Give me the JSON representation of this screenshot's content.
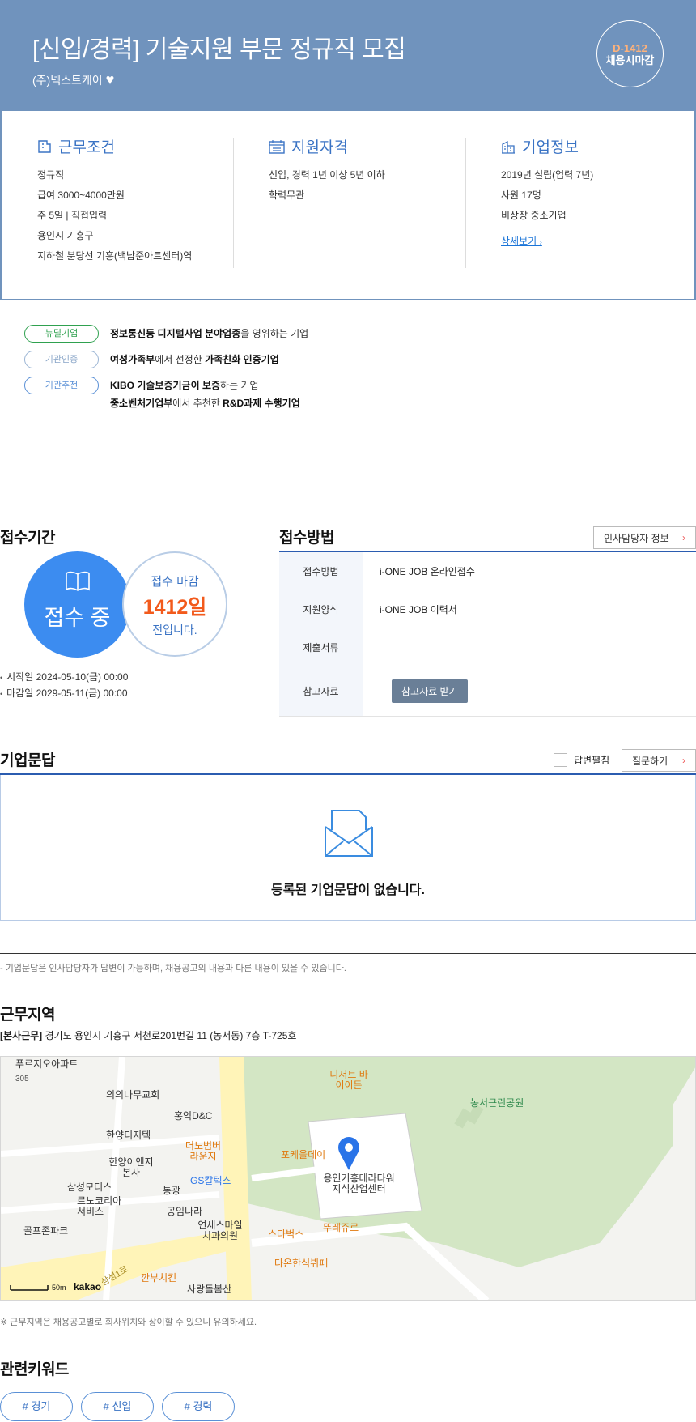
{
  "header": {
    "title": "[신입/경력] 기술지원 부문 정규직 모집",
    "company": "(주)넥스트케이",
    "dday": "D-1412",
    "deadline_type": "채용시마감",
    "bg_color": "#7093bd"
  },
  "conditions": {
    "title": "근무조건",
    "items": [
      "정규직",
      "급여 3000~4000만원",
      "주 5일 | 직접입력",
      "용인시 기흥구",
      "지하철 분당선 기흥(백남준아트센터)역"
    ]
  },
  "qualification": {
    "title": "지원자격",
    "items": [
      "신입, 경력 1년 이상 5년 이하",
      "학력무관"
    ]
  },
  "company_info": {
    "title": "기업정보",
    "items": [
      "2019년 설립(업력 7년)",
      "사원 17명",
      "비상장 중소기업"
    ],
    "more_label": "상세보기"
  },
  "badges": [
    {
      "label": "뉴딜기업",
      "lines": [
        [
          {
            "b": "정보통신등 디지털사업 분야업종"
          },
          {
            "t": "을 영위하는 기업"
          }
        ]
      ]
    },
    {
      "label": "기관인증",
      "lines": [
        [
          {
            "b": "여성가족부"
          },
          {
            "t": "에서 선정한 "
          },
          {
            "b": "가족친화 인증기업"
          }
        ]
      ]
    },
    {
      "label": "기관추천",
      "lines": [
        [
          {
            "b": "KIBO 기술보증기금이 보증"
          },
          {
            "t": "하는 기업"
          }
        ],
        [
          {
            "b": "중소벤처기업부"
          },
          {
            "t": "에서 추천한 "
          },
          {
            "b": "R&D과제 수행기업"
          }
        ]
      ]
    }
  ],
  "period": {
    "title": "접수기간",
    "status": "접수 중",
    "remain_top": "접수 마감",
    "remain_days": "1412일",
    "remain_bottom": "전입니다.",
    "start": "시작일 2024-05-10(금) 00:00",
    "end": "마감일 2029-05-11(금) 00:00"
  },
  "method": {
    "title": "접수방법",
    "hr_button": "인사담당자 정보",
    "rows": [
      {
        "key": "접수방법",
        "value": "i-ONE JOB 온라인접수"
      },
      {
        "key": "지원양식",
        "value": "i-ONE JOB 이력서"
      },
      {
        "key": "제출서류",
        "value": ""
      },
      {
        "key": "참고자료",
        "value": ""
      }
    ],
    "download_button": "참고자료 받기"
  },
  "qa": {
    "title": "기업문답",
    "expand_label": "답변펼침",
    "ask_button": "질문하기",
    "empty_message": "등록된 기업문답이 없습니다.",
    "note": "- 기업문답은 인사담당자가 답변이 가능하며, 채용공고의 내용과 다른 내용이 있을 수 있습니다."
  },
  "location": {
    "title": "근무지역",
    "tag": "[본사근무]",
    "address": "경기도 용인시 기흥구 서천로201번길 11 (농서동) 7층 T-725호",
    "note": "※ 근무지역은 채용공고별로 회사위치와 상이할 수 있으니 유의하세요.",
    "map_labels": [
      "푸르지오아파트",
      "305",
      "의의나무교회",
      "홍익D&C",
      "한양디지텍",
      "더노범버 라운지",
      "한양이엔지 본사",
      "삼성모터스",
      "통광",
      "GS칼텍스",
      "르노코리아 서비스",
      "공임나라",
      "연세스마일 치과의원",
      "골프존파크",
      "깐부치킨",
      "사랑돌봄산",
      "삼성1로",
      "디저트 바이이든",
      "농서근린공원",
      "포케올데이",
      "용인기흥테라타워 지식산업센터",
      "스타벅스",
      "뚜레쥬르",
      "다온한식뷔페",
      "50m",
      "kakao"
    ]
  },
  "keywords": {
    "title": "관련키워드",
    "items": [
      "# 경기",
      "# 신입",
      "# 경력"
    ]
  }
}
